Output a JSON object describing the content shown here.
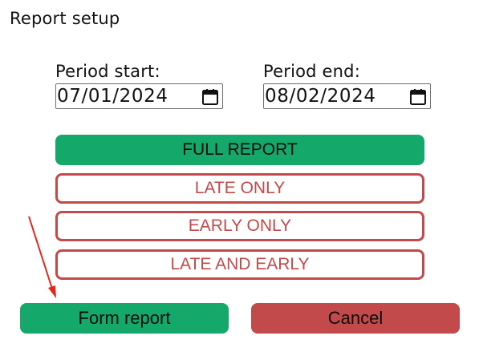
{
  "window": {
    "title": "Report setup"
  },
  "period_start": {
    "label": "Period start:",
    "value": "07/01/2024",
    "icon": "calendar-icon"
  },
  "period_end": {
    "label": "Period end:",
    "value": "08/02/2024",
    "icon": "calendar-icon"
  },
  "report_types": [
    {
      "label": "FULL REPORT",
      "selected": true
    },
    {
      "label": "LATE ONLY",
      "selected": false
    },
    {
      "label": "EARLY ONLY",
      "selected": false
    },
    {
      "label": "LATE AND EARLY",
      "selected": false
    }
  ],
  "actions": {
    "form_report": "Form report",
    "cancel": "Cancel"
  },
  "colors": {
    "primary_green": "#14a86b",
    "accent_red": "#c24a4a",
    "annotation_red": "#e0281f"
  }
}
